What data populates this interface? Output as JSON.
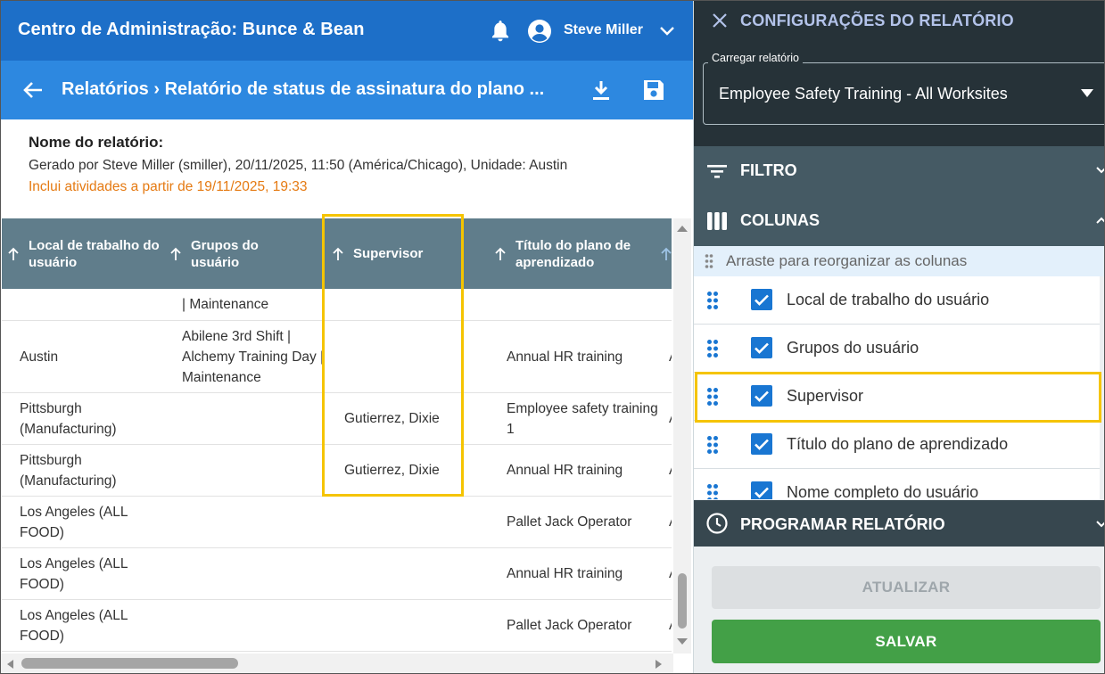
{
  "header": {
    "app_title": "Centro de Administração: Bunce & Bean",
    "user_name": "Steve Miller"
  },
  "subheader": {
    "breadcrumb": "Relatórios › Relatório de status de assinatura do plano ..."
  },
  "report": {
    "name_label": "Nome do relatório:",
    "generated": "Gerado por Steve Miller (smiller), 20/11/2025, 11:50 (América/Chicago), Unidade: Austin",
    "includes": "Inclui atividades a partir de 19/11/2025, 19:33"
  },
  "table": {
    "columns": [
      "Local de trabalho do usuário",
      "Grupos do usuário",
      "Supervisor",
      "Título do plano de aprendizado"
    ],
    "rows": [
      {
        "local": "",
        "groups": "| Maintenance",
        "supervisor": "",
        "title": ""
      },
      {
        "local": "Austin",
        "groups": "Abilene 3rd Shift | Alchemy Training Day | Maintenance",
        "supervisor": "",
        "title": "Annual HR training"
      },
      {
        "local": "Pittsburgh (Manufacturing)",
        "groups": "",
        "supervisor": "Gutierrez, Dixie",
        "title": "Employee safety training 1"
      },
      {
        "local": "Pittsburgh (Manufacturing)",
        "groups": "",
        "supervisor": "Gutierrez, Dixie",
        "title": "Annual HR training"
      },
      {
        "local": "Los Angeles (ALL FOOD)",
        "groups": "",
        "supervisor": "",
        "title": "Pallet Jack Operator"
      },
      {
        "local": "Los Angeles (ALL FOOD)",
        "groups": "",
        "supervisor": "",
        "title": "Annual HR training"
      },
      {
        "local": "Los Angeles (ALL FOOD)",
        "groups": "",
        "supervisor": "",
        "title": "Pallet Jack Operator"
      }
    ]
  },
  "panel": {
    "title": "CONFIGURAÇÕES DO RELATÓRIO",
    "load_label": "Carregar relatório",
    "load_value": "Employee Safety Training - All Worksites",
    "filter_title": "FILTRO",
    "columns_title": "COLUNAS",
    "drag_hint": "Arraste para reorganizar as colunas",
    "column_items": [
      "Local de trabalho do usuário",
      "Grupos do usuário",
      "Supervisor",
      "Título do plano de aprendizado",
      "Nome completo do usuário"
    ],
    "schedule_title": "PROGRAMAR RELATÓRIO",
    "update_label": "ATUALIZAR",
    "save_label": "SALVAR"
  },
  "colors": {
    "app_bar": "#1d6fc8",
    "sub_bar": "#2d88e0",
    "table_header": "#607d8b",
    "panel_dark": "#263238",
    "section": "#455a64",
    "highlight": "#f5c400",
    "save_button": "#43a047",
    "checkbox": "#1976d2"
  }
}
